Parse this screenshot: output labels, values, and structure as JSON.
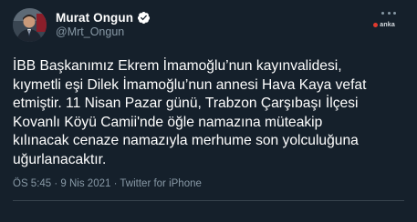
{
  "author": {
    "name": "Murat Ongun",
    "handle": "@Mrt_Ongun",
    "verified": true
  },
  "watermark": {
    "text": "anka",
    "accent": "#e03a2e"
  },
  "tweet": {
    "text": "İBB Başkanımız Ekrem İmamoğlu’nun kayınvalidesi,\nkıymetli eşi Dilek İmamoğlu’nun annesi Hava Kaya vefat\netmiştir. 11 Nisan Pazar günü, Trabzon Çarşıbaşı İlçesi\nKovanlı Köyü Camii'nde öğle namazına müteakip\nkılınacak cenaze namazıyla merhume son yolculuğuna\nuğurlanacaktır.",
    "meta": "ÖS 5:45 · 9 Nis 2021 · Twitter for iPhone"
  },
  "icons": {
    "more": "more-dots-icon",
    "verified": "verified-badge-icon"
  },
  "colors": {
    "background": "#15202b",
    "text": "#ffffff",
    "secondary": "#8899a6",
    "verified": "#ffffff"
  }
}
